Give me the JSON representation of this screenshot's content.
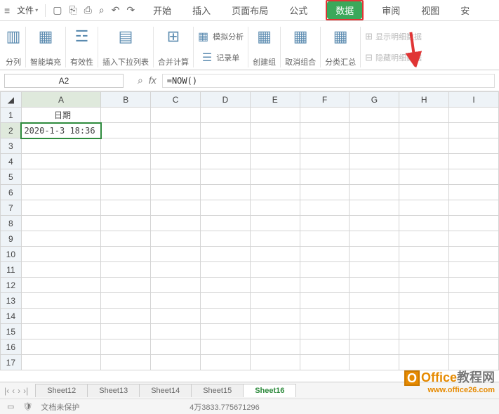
{
  "toolbar": {
    "file_label": "文件"
  },
  "tabs": {
    "start": "开始",
    "insert": "插入",
    "layout": "页面布局",
    "formula": "公式",
    "data": "数据",
    "review": "审阅",
    "view": "视图",
    "secure": "安"
  },
  "ribbon": {
    "col_split": "分列",
    "smart_fill": "智能填充",
    "validity": "有效性",
    "dropdown": "插入下拉列表",
    "consolidate": "合并计算",
    "simulate": "模拟分析",
    "record": "记录单",
    "group": "创建组",
    "ungroup": "取消组合",
    "subtotal": "分类汇总",
    "show_detail": "显示明细数据",
    "hide_detail": "隐藏明细数据"
  },
  "namebox": "A2",
  "formula": "=NOW()",
  "columns": [
    "A",
    "B",
    "C",
    "D",
    "E",
    "F",
    "G",
    "H",
    "I"
  ],
  "rows": [
    "1",
    "2",
    "3",
    "4",
    "5",
    "6",
    "7",
    "8",
    "9",
    "10",
    "11",
    "12",
    "13",
    "14",
    "15",
    "16",
    "17"
  ],
  "cells": {
    "a1": "日期",
    "a2": "2020-1-3 18:36"
  },
  "sheets": {
    "s12": "Sheet12",
    "s13": "Sheet13",
    "s14": "Sheet14",
    "s15": "Sheet15",
    "s16": "Sheet16"
  },
  "status": {
    "protect": "文档未保护",
    "avg": "4万3833.775671296"
  },
  "watermark": {
    "title_office": "Office",
    "title_cn": "教程网",
    "url": "www.office26.com"
  }
}
